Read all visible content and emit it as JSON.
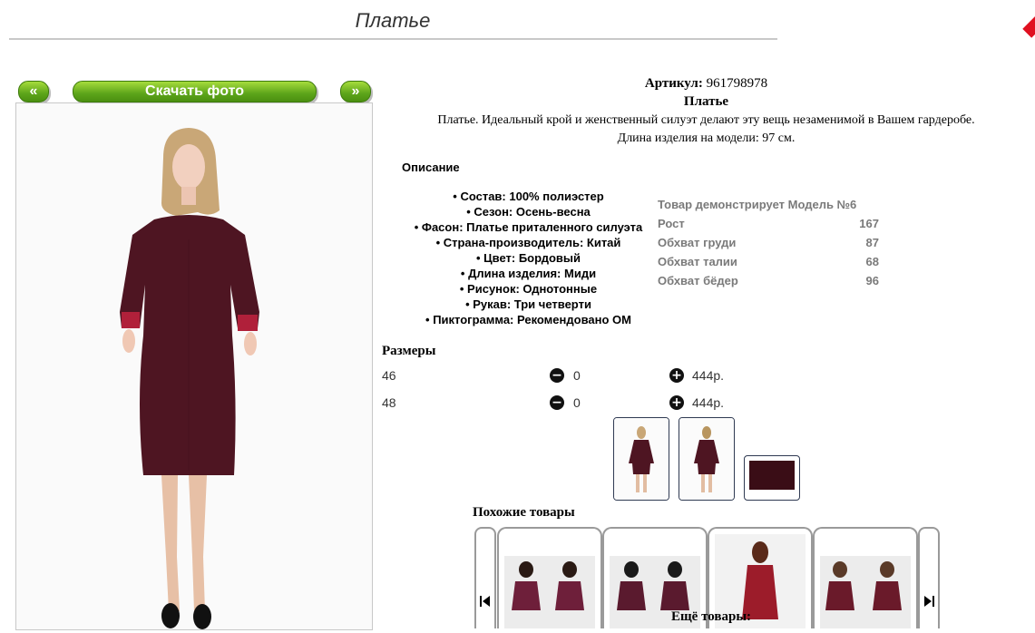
{
  "header": {
    "title": "Платье"
  },
  "gallery": {
    "prev_label": "«",
    "download_label": "Скачать фото",
    "next_label": "»"
  },
  "product": {
    "article_label": "Артикул:",
    "article_value": "961798978",
    "name": "Платье",
    "description_line1": "Платье. Идеальный крой и женственный силуэт делают эту вещь незаменимой в Вашем гардеробе.",
    "description_line2": "Длина изделия на модели: 97 см.",
    "dress_color": "#4e1522"
  },
  "description": {
    "title": "Описание",
    "specs": [
      "• Состав: 100% полиэстер",
      "• Сезон: Осень-весна",
      "• Фасон: Платье приталенного силуэта",
      "• Страна-производитель: Китай",
      "• Цвет: Бордовый",
      "• Длина изделия: Миди",
      "• Рисунок: Однотонные",
      "• Рукав: Три четверти",
      "• Пиктограмма: Рекомендовано ОМ"
    ]
  },
  "model": {
    "title": "Товар демонстрирует Модель №6",
    "rows": [
      {
        "label": "Рост",
        "value": "167"
      },
      {
        "label": "Обхват груди",
        "value": "87"
      },
      {
        "label": "Обхват талии",
        "value": "68"
      },
      {
        "label": "Обхват бёдер",
        "value": "96"
      }
    ]
  },
  "sizes": {
    "title": "Размеры",
    "minus_icon": "minus-circle-icon",
    "plus_icon": "plus-circle-icon",
    "rows": [
      {
        "size": "46",
        "qty": "0",
        "price": "444р."
      },
      {
        "size": "48",
        "qty": "0",
        "price": "444р."
      }
    ]
  },
  "similar": {
    "title": "Похожие товары",
    "prev_icon": "skip-back-icon",
    "next_icon": "skip-forward-icon"
  },
  "more": {
    "title": "Ещё товары:"
  }
}
